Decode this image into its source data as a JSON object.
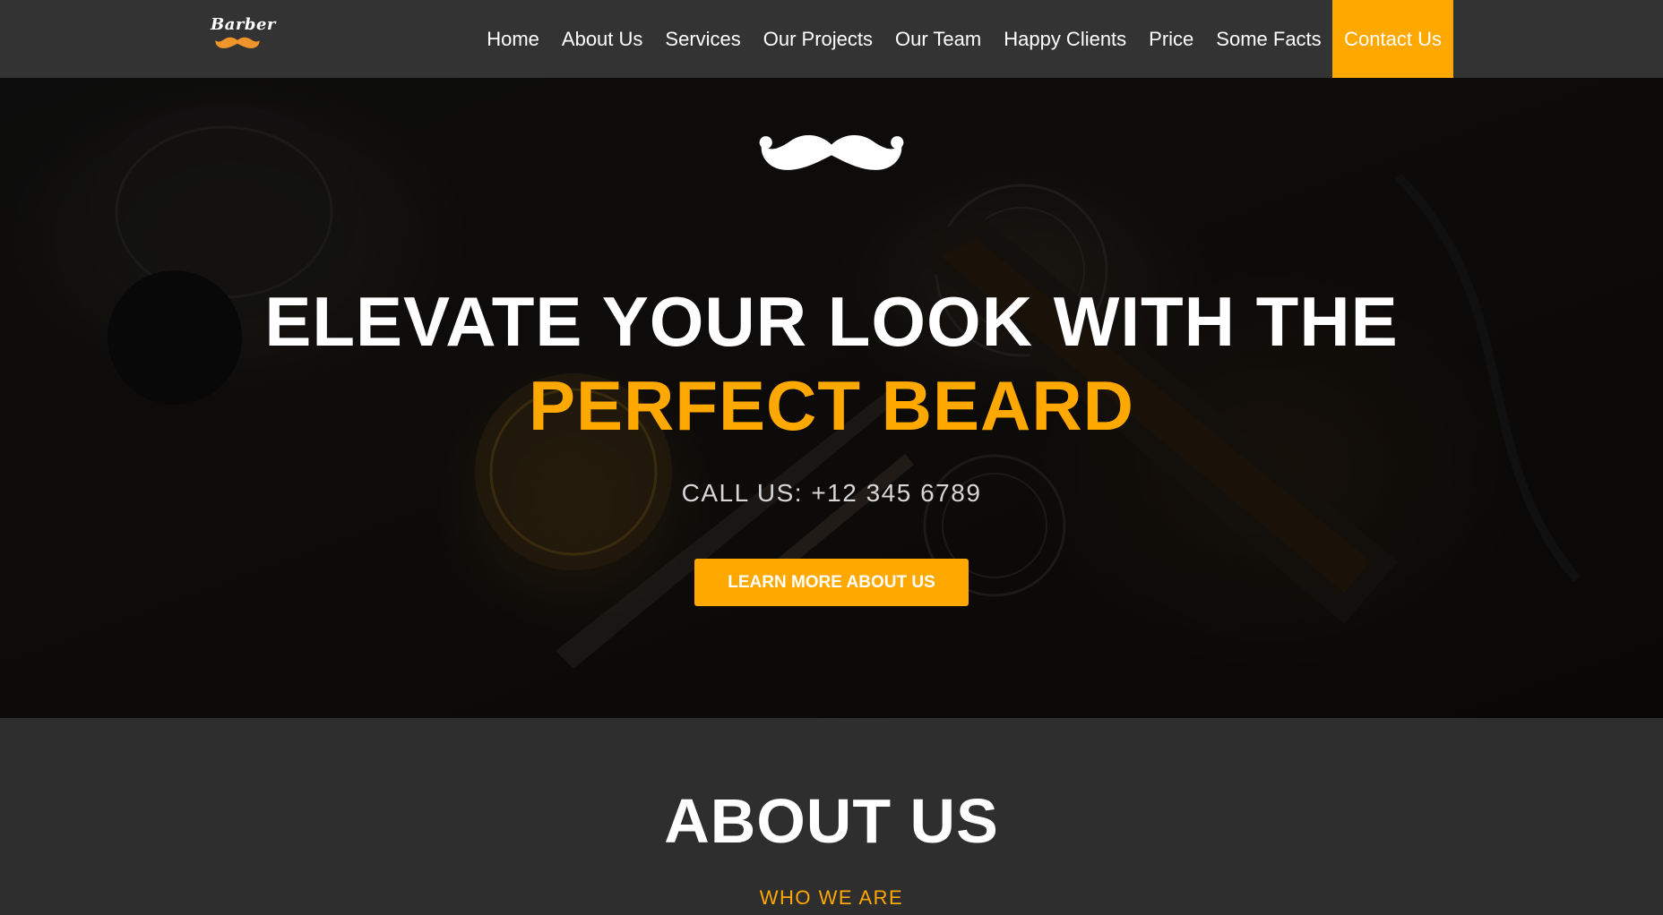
{
  "brand": {
    "logo_text": "Barber",
    "logo_icon": "mustache-icon",
    "accent_color": "#ffa800"
  },
  "nav": {
    "items": [
      {
        "label": "Home"
      },
      {
        "label": "About Us"
      },
      {
        "label": "Services"
      },
      {
        "label": "Our Projects"
      },
      {
        "label": "Our Team"
      },
      {
        "label": "Happy Clients"
      },
      {
        "label": "Price"
      },
      {
        "label": "Some Facts"
      },
      {
        "label": "Contact Us",
        "active": true
      }
    ]
  },
  "hero": {
    "icon": "mustache-icon",
    "title_line1": "ELEVATE YOUR LOOK WITH THE",
    "title_line2": "PERFECT BEARD",
    "call_text": "CALL US: +12 345 6789",
    "button_label": "LEARN MORE ABOUT US"
  },
  "about": {
    "title": "ABOUT US",
    "subtitle": "WHO WE ARE"
  }
}
